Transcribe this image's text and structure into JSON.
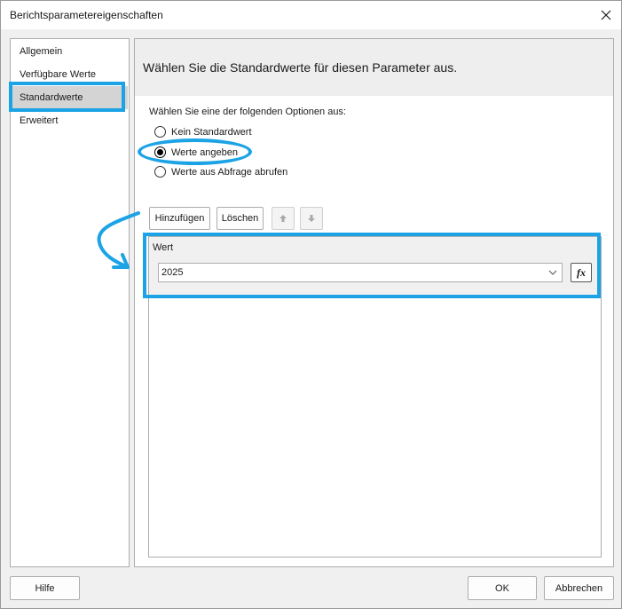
{
  "window": {
    "title": "Berichtsparametereigenschaften",
    "close_icon": "close-icon"
  },
  "nav": {
    "items": [
      {
        "label": "Allgemein"
      },
      {
        "label": "Verfügbare Werte"
      },
      {
        "label": "Standardwerte",
        "selected": true
      },
      {
        "label": "Erweitert"
      }
    ]
  },
  "content": {
    "header": "Wählen Sie die Standardwerte für diesen Parameter aus.",
    "options_label": "Wählen Sie eine der folgenden Optionen aus:",
    "radios": [
      {
        "label": "Kein Standardwert",
        "checked": false
      },
      {
        "label": "Werte angeben",
        "checked": true
      },
      {
        "label": "Werte aus Abfrage abrufen",
        "checked": false
      }
    ],
    "toolbar": {
      "add_label": "Hinzufügen",
      "delete_label": "Löschen",
      "up_icon": "arrow-up-icon",
      "down_icon": "arrow-down-icon"
    },
    "grid": {
      "column_header": "Wert",
      "rows": [
        {
          "value": "2025"
        }
      ],
      "expression_button": "fx"
    }
  },
  "footer": {
    "help_label": "Hilfe",
    "ok_label": "OK",
    "cancel_label": "Abbrechen"
  },
  "colors": {
    "annotation": "#1ca3e6",
    "nav_selected": "#d4d4d4",
    "header_bg": "#eeeeee"
  }
}
